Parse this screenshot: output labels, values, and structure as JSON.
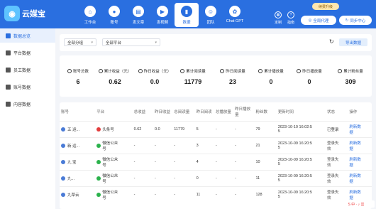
{
  "header": {
    "logo_text": "云媒宝",
    "nav": [
      {
        "label": "工作台",
        "icon": "home-icon",
        "glyph": "⌂"
      },
      {
        "label": "账号",
        "icon": "user-icon",
        "glyph": "●"
      },
      {
        "label": "发文章",
        "icon": "article-icon",
        "glyph": "▤"
      },
      {
        "label": "发视频",
        "icon": "video-icon",
        "glyph": "▶"
      },
      {
        "label": "数据",
        "icon": "chart-icon",
        "glyph": "▮"
      },
      {
        "label": "团队",
        "icon": "team-icon",
        "glyph": "☺"
      },
      {
        "label": "Chat GPT",
        "icon": "gpt-icon",
        "glyph": "✿"
      }
    ],
    "active_nav": 4,
    "upgrade_label": "续费升级",
    "customize_label": "定制",
    "guide_label": "指南",
    "proxy_label": "全局代理",
    "sync_label": "同步中心"
  },
  "sidebar": {
    "items": [
      {
        "label": "数据总览",
        "icon": "overview-icon"
      },
      {
        "label": "平台数据",
        "icon": "platform-icon"
      },
      {
        "label": "员工数据",
        "icon": "staff-icon"
      },
      {
        "label": "账号数据",
        "icon": "account-icon"
      },
      {
        "label": "内容数据",
        "icon": "content-icon"
      }
    ],
    "active": 0
  },
  "filters": {
    "group_select": "全部分组",
    "platform_select": "全部平台",
    "export_label": "导出数据"
  },
  "stats": [
    {
      "label": "账号总数",
      "value": "6"
    },
    {
      "label": "累计收益（元）",
      "value": "0.62"
    },
    {
      "label": "昨日收益（元）",
      "value": "0.0"
    },
    {
      "label": "累计阅读量",
      "value": "11779"
    },
    {
      "label": "昨日阅读量",
      "value": "23"
    },
    {
      "label": "累计播放量",
      "value": "0"
    },
    {
      "label": "昨日播放量",
      "value": "0"
    },
    {
      "label": "累计粉丝量",
      "value": "309"
    }
  ],
  "table": {
    "headers": [
      "账号",
      "平台",
      "总收益",
      "昨日收益",
      "总阅读量",
      "昨日阅读",
      "总播放量",
      "昨日播放量",
      "粉丝数",
      "更新时间",
      "状态",
      "操作"
    ],
    "rows": [
      {
        "account": "五      运...",
        "platform": "头条号",
        "platform_color": "#e33d3d",
        "total_income": "0.62",
        "yday_income": "0.0",
        "total_read": "11779",
        "yday_read": "5",
        "total_play": "-",
        "yday_play": "-",
        "fans": "79",
        "updated": "2023-10-10 16:02:5\n5",
        "status": "已登录",
        "ops": [
          "刷新数",
          "据"
        ]
      },
      {
        "account": "新      运...",
        "platform": "微信公众\n号",
        "platform_color": "#2bb24c",
        "total_income": "-",
        "yday_income": "-",
        "total_read": "-",
        "yday_read": "3",
        "total_play": "-",
        "yday_play": "-",
        "fans": "21",
        "updated": "2023-10-09 16:20:5\n5",
        "status": "登录失\n效",
        "ops": [
          "刷新数",
          "据"
        ]
      },
      {
        "account": "九      宝",
        "platform": "微信公众\n号",
        "platform_color": "#2bb24c",
        "total_income": "-",
        "yday_income": "-",
        "total_read": "-",
        "yday_read": "4",
        "total_play": "-",
        "yday_play": "-",
        "fans": "10",
        "updated": "2023-10-09 16:20:5\n5",
        "status": "登录失\n效",
        "ops": [
          "刷新数",
          "据"
        ]
      },
      {
        "account": "九...",
        "platform": "微信公众\n号",
        "platform_color": "#2bb24c",
        "total_income": "-",
        "yday_income": "-",
        "total_read": "-",
        "yday_read": "0",
        "total_play": "-",
        "yday_play": "-",
        "fans": "11",
        "updated": "2023-10-09 16:20:5\n5",
        "status": "登录失\n效",
        "ops": [
          "刷新数",
          "据"
        ]
      },
      {
        "account": "九草云",
        "platform": "微信公众\n号",
        "platform_color": "#2bb24c",
        "total_income": "-",
        "yday_income": "-",
        "total_read": "-",
        "yday_read": "11",
        "total_play": "-",
        "yday_play": "-",
        "fans": "128",
        "updated": "2023-10-09 16:20:5\n5",
        "status": "登录失\n效",
        "ops": [
          "刷新数",
          "据"
        ]
      }
    ]
  },
  "tray": {
    "label": "S 中 · ♪ ▦"
  }
}
